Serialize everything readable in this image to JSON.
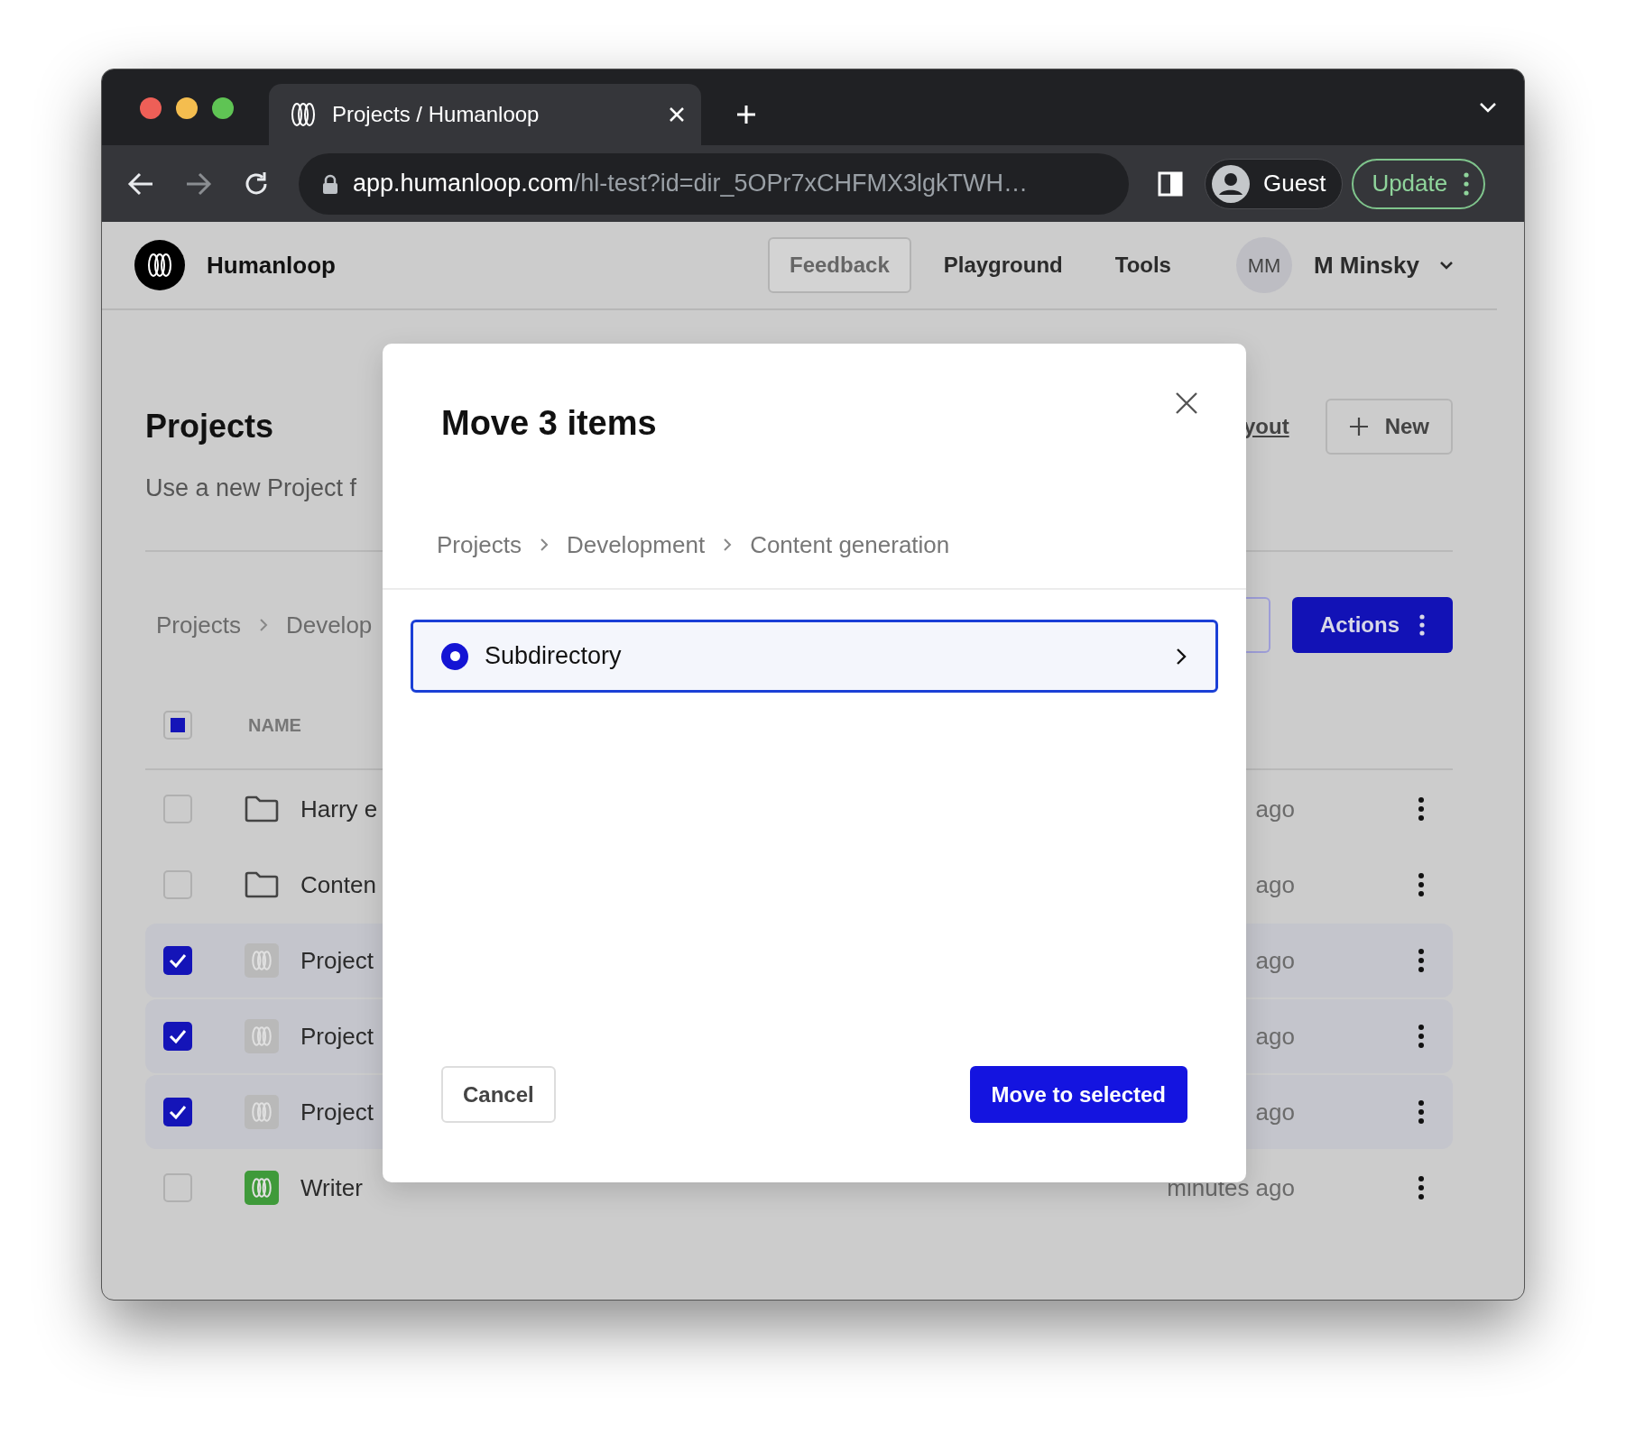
{
  "browser": {
    "tab": {
      "title": "Projects / Humanloop"
    },
    "url": {
      "host": "app.humanloop.com",
      "path": "/hl-test?id=dir_5OPr7xCHFMX3lgkTWH…"
    },
    "profile": "Guest",
    "update_button": "Update"
  },
  "header": {
    "brand": "Humanloop",
    "nav": [
      {
        "label": "Feedback",
        "kind": "button"
      },
      {
        "label": "Playground",
        "kind": "link"
      },
      {
        "label": "Tools",
        "kind": "link"
      }
    ],
    "user": {
      "initials": "MM",
      "name": "M Minsky"
    }
  },
  "page": {
    "title": "Projects",
    "subtitle": "Use a new Project f",
    "layout_link": "yout",
    "new_button": "New",
    "breadcrumb": [
      "Projects",
      "Develop"
    ],
    "actions_button": "Actions"
  },
  "table": {
    "select_all": {
      "indeterminate": true
    },
    "column_1": "NAME",
    "rows": [
      {
        "kind": "folder",
        "name": "Harry e",
        "time": "ago",
        "checked": false
      },
      {
        "kind": "folder",
        "name": "Conten",
        "time": "ago",
        "checked": false
      },
      {
        "kind": "project",
        "name": "Project",
        "time": "ago",
        "checked": true,
        "color": "#b9b9b9"
      },
      {
        "kind": "project",
        "name": "Project",
        "time": "ago",
        "checked": true,
        "color": "#b9b9b9"
      },
      {
        "kind": "project",
        "name": "Project",
        "time": "ago",
        "checked": true,
        "color": "#b9b9b9"
      },
      {
        "kind": "project",
        "name": "Writer",
        "time": "minutes ago",
        "checked": false,
        "color": "#3f9a3a"
      }
    ]
  },
  "modal": {
    "title": "Move 3 items",
    "breadcrumb": [
      "Projects",
      "Development",
      "Content generation"
    ],
    "items": [
      {
        "label": "Subdirectory",
        "selected": true
      }
    ],
    "cancel_button": "Cancel",
    "confirm_button": "Move to selected"
  }
}
